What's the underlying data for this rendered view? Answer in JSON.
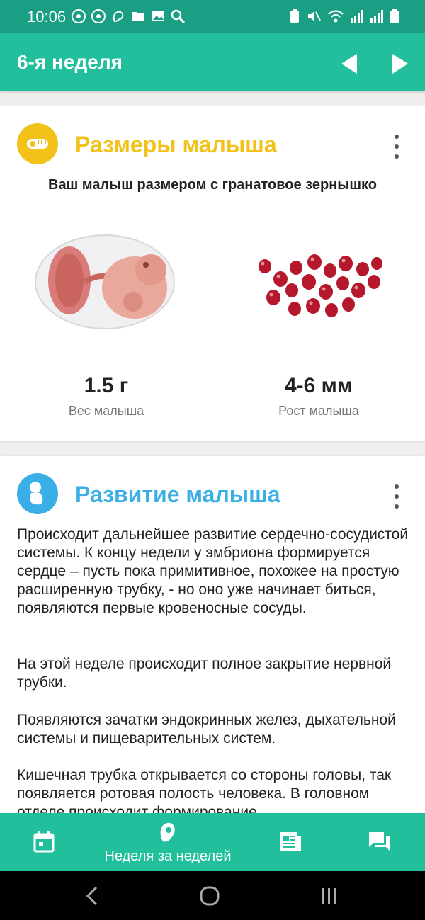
{
  "status": {
    "time": "10:06"
  },
  "appbar": {
    "title": "6-я неделя"
  },
  "size_card": {
    "title": "Размеры малыша",
    "subtitle": "Ваш малыш размером с гранатовое зернышко",
    "weight_value": "1.5 г",
    "weight_label": "Вес малыша",
    "height_value": "4-6 мм",
    "height_label": "Рост малыша"
  },
  "dev_card": {
    "title": "Развитие малыша",
    "paragraphs": [
      "Происходит дальнейшее развитие сердечно-сосудистой системы. К концу недели у эмбриона формируется сердце – пусть пока примитивное, похожее на простую расширенную трубку, - но оно уже начинает биться, появляются первые кровеносные сосуды.",
      "На этой неделе происходит полное закрытие нервной трубки.",
      "Появляются зачатки эндокринных желез, дыхательной системы и пищеварительных систем.",
      "Кишечная трубка открывается со стороны головы, так появляется ротовая полость человека. В головном отделе происходит формирование"
    ]
  },
  "bottom_nav": {
    "active_label": "Неделя за неделей"
  },
  "colors": {
    "primary": "#22bf9c",
    "status": "#1a9f84",
    "yellow": "#f2c21b",
    "blue": "#3aaee6"
  }
}
